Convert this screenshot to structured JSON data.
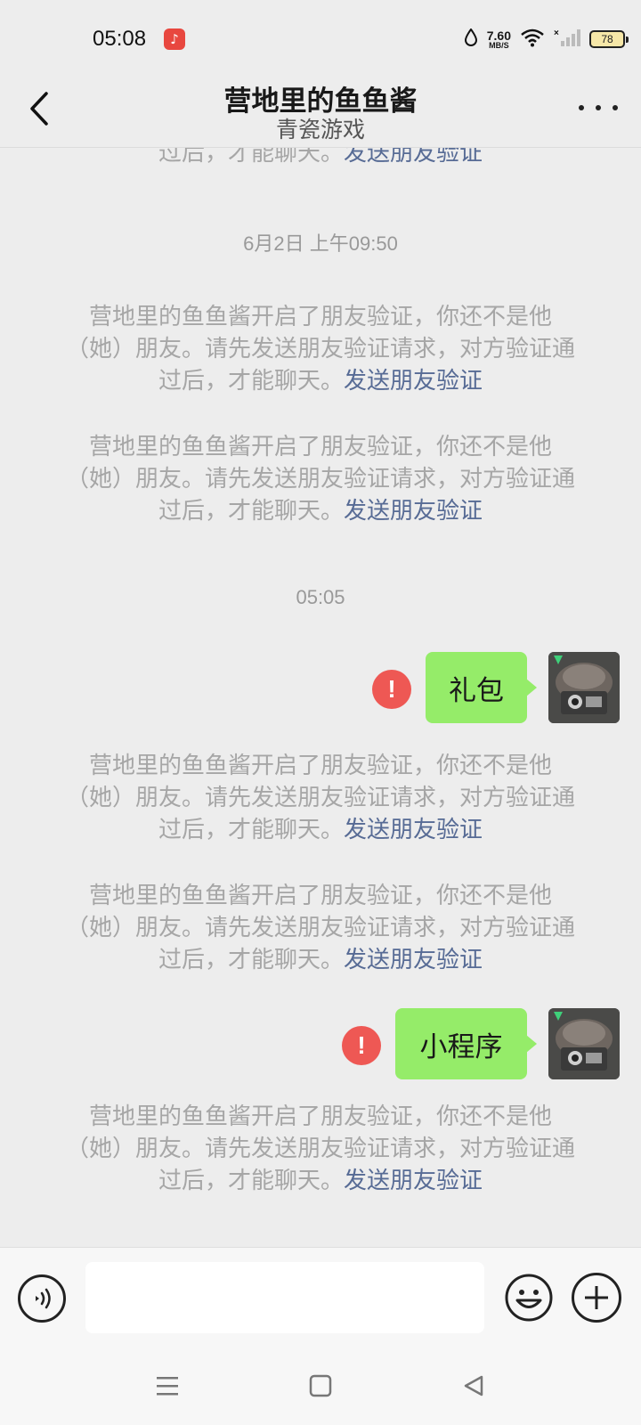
{
  "status_bar": {
    "time": "05:08",
    "app_icon": "music-note-icon",
    "net_speed_value": "7.60",
    "net_speed_unit": "MB/S",
    "battery": "78"
  },
  "header": {
    "title": "营地里的鱼鱼酱",
    "subtitle": "青瓷游戏"
  },
  "messages": {
    "partial_notice": {
      "text": "过后，才能聊天。",
      "link": "发送朋友验证"
    },
    "timestamps": [
      "6月2日 上午09:50",
      "05:05"
    ],
    "system_notice": {
      "line1": "营地里的鱼鱼酱开启了朋友验证，你还不是他",
      "line2": "（她）朋友。请先发送朋友验证请求，对方验证通",
      "line3": "过后，才能聊天。",
      "link": "发送朋友验证"
    },
    "sent": [
      {
        "text": "礼包",
        "status": "failed"
      },
      {
        "text": "小程序",
        "status": "failed"
      }
    ]
  },
  "input_bar": {
    "placeholder": "",
    "value": ""
  },
  "colors": {
    "bubble": "#95ec69",
    "link": "#576b95",
    "error": "#ee5854",
    "background": "#ededed"
  }
}
